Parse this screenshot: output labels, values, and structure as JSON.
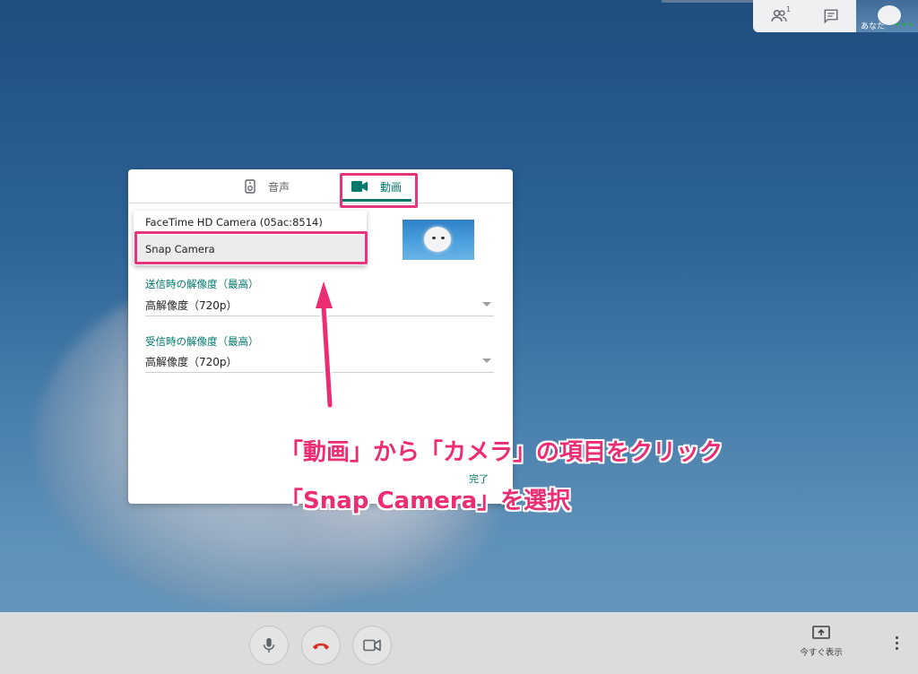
{
  "top_panel": {
    "people_count": "1",
    "self_label": "あなた",
    "self_menu": "•••"
  },
  "dialog": {
    "tabs": [
      {
        "label": "音声",
        "icon": "speaker-icon"
      },
      {
        "label": "動画",
        "icon": "videocam-icon",
        "selected": true
      }
    ],
    "camera_options": [
      "FaceTime HD Camera (05ac:8514)",
      "Snap Camera"
    ],
    "highlighted_camera": "Snap Camera",
    "send_resolution": {
      "label": "送信時の解像度（最高）",
      "value": "高解像度（720p）"
    },
    "receive_resolution": {
      "label": "受信時の解像度（最高）",
      "value": "高解像度（720p）"
    },
    "done_label": "完了"
  },
  "annotation": {
    "line1": "「動画」から「カメラ」の項目をクリック",
    "line2": "「Snap Camera」を選択",
    "color": "#ec2d74"
  },
  "bottom_bar": {
    "present_label": "今すぐ表示",
    "mic_icon": "mic-icon",
    "end_call_icon": "end-call-icon",
    "camera_icon": "videocam-icon",
    "more_icon": "more-vert-icon"
  },
  "colors": {
    "accent": "#00796b",
    "highlight": "#e6357e",
    "end_call": "#d93025"
  }
}
